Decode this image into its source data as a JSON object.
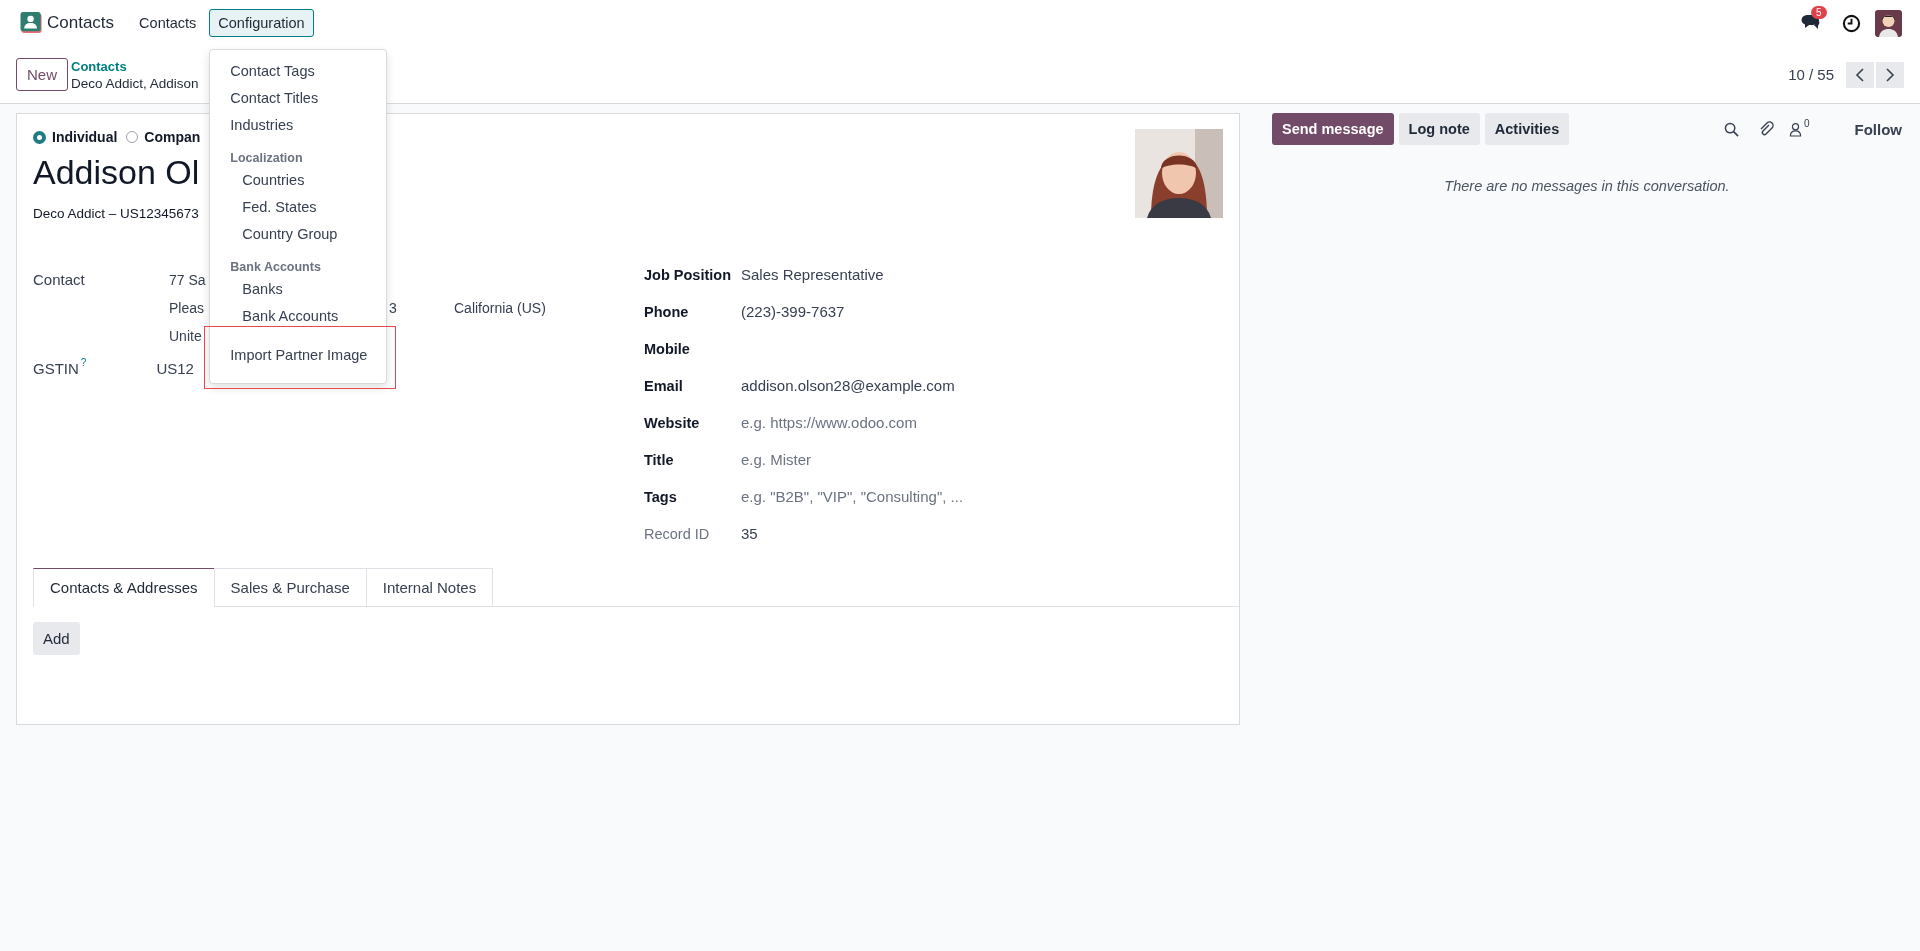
{
  "app_bar": {
    "app_name": "Contacts",
    "menu": [
      {
        "label": "Contacts",
        "open": false
      },
      {
        "label": "Configuration",
        "open": true
      }
    ],
    "messages_badge": "5"
  },
  "config_menu": [
    {
      "kind": "item",
      "label": "Contact Tags",
      "highlighted": false
    },
    {
      "kind": "item",
      "label": "Contact Titles",
      "highlighted": false
    },
    {
      "kind": "item",
      "label": "Industries",
      "highlighted": false
    },
    {
      "kind": "header",
      "label": "Localization",
      "highlighted": false
    },
    {
      "kind": "subitem",
      "label": "Countries",
      "highlighted": false
    },
    {
      "kind": "subitem",
      "label": "Fed. States",
      "highlighted": false
    },
    {
      "kind": "subitem",
      "label": "Country Group",
      "highlighted": false
    },
    {
      "kind": "header",
      "label": "Bank Accounts",
      "highlighted": false
    },
    {
      "kind": "subitem",
      "label": "Banks",
      "highlighted": false
    },
    {
      "kind": "subitem",
      "label": "Bank Accounts",
      "highlighted": false
    },
    {
      "kind": "item",
      "label": "Import Partner Image",
      "highlighted": true
    }
  ],
  "control_panel": {
    "new_button": "New",
    "breadcrumb_parent": "Contacts",
    "breadcrumb_current": "Deco Addict, Addison",
    "pager": "10 / 55"
  },
  "form": {
    "types": [
      {
        "label": "Individual",
        "selected": true
      },
      {
        "label": "Compan",
        "selected": false
      }
    ],
    "name": "Addison Ol",
    "company_line": "Deco Addict – US12345673",
    "contact_label": "Contact",
    "address": {
      "street": "77 Sa",
      "city": "Pleas",
      "zip": "3",
      "state": "California (US)",
      "country": "Unite"
    },
    "gstin_label": "GSTIN",
    "gstin_help": "?",
    "gstin": "US12",
    "fields": [
      {
        "kind": "field",
        "label": "Job Position",
        "value": "Sales Representative"
      },
      {
        "kind": "field",
        "label": "Phone",
        "value": "(223)-399-7637"
      },
      {
        "kind": "field",
        "label": "Mobile"
      },
      {
        "kind": "field",
        "label": "Email",
        "value": "addison.olson28@example.com"
      },
      {
        "kind": "field",
        "label": "Website",
        "placeholder": "e.g. https://www.odoo.com"
      },
      {
        "kind": "field",
        "label": "Title",
        "placeholder": "e.g. Mister"
      },
      {
        "kind": "field",
        "label": "Tags",
        "placeholder": "e.g. \"B2B\", \"VIP\", \"Consulting\", ..."
      },
      {
        "kind": "info",
        "label": "Record ID",
        "value": "35"
      }
    ],
    "tabs": [
      {
        "label": "Contacts & Addresses",
        "selected": true
      },
      {
        "label": "Sales & Purchase",
        "selected": false
      },
      {
        "label": "Internal Notes",
        "selected": false
      }
    ],
    "add_button": "Add"
  },
  "chatter": {
    "buttons": [
      {
        "label": "Send message",
        "primary": true
      },
      {
        "label": "Log note",
        "primary": false
      },
      {
        "label": "Activities",
        "primary": false
      }
    ],
    "followers_count": "0",
    "follow": "Follow",
    "empty_message": "There are no messages in this conversation."
  }
}
